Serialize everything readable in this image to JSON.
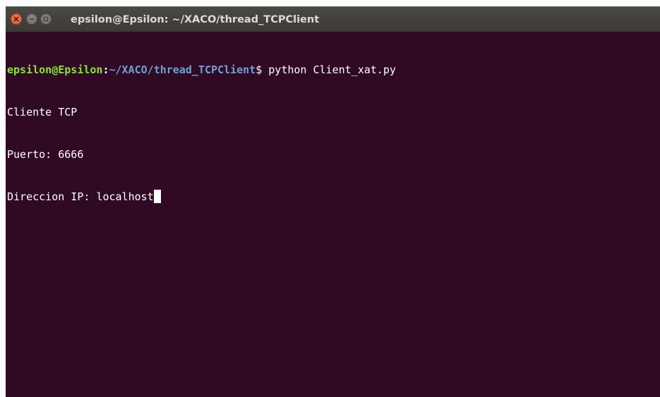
{
  "window": {
    "title": "epsilon@Epsilon: ~/XACO/thread_TCPClient",
    "buttons": {
      "close": "close-icon",
      "minimize": "minimize-icon",
      "maximize": "maximize-icon"
    }
  },
  "terminal": {
    "prompt": {
      "user_host": "epsilon@Epsilon",
      "separator": ":",
      "path": "~/XACO/thread_TCPClient",
      "symbol": "$",
      "command": " python Client_xat.py"
    },
    "output": [
      "Cliente TCP",
      "Puerto: 6666"
    ],
    "input_line": {
      "label": "Direccion IP: ",
      "value": "localhost"
    }
  },
  "colors": {
    "background": "#300a24",
    "prompt_user": "#8ae234",
    "prompt_path": "#729fcf",
    "text": "#ffffff",
    "titlebar": "#3c3b37",
    "close_button": "#e4572e"
  }
}
